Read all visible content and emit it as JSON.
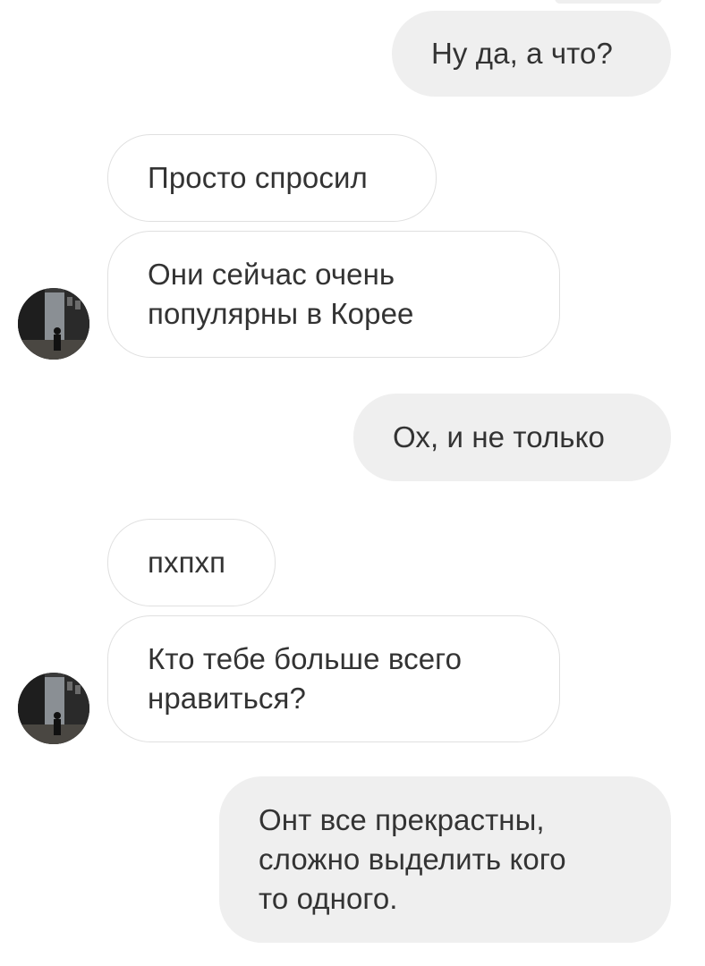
{
  "messages": [
    {
      "id": "m1",
      "side": "outgoing",
      "text": "Ну да, а что?"
    },
    {
      "id": "m2",
      "side": "incoming",
      "text": "Просто спросил"
    },
    {
      "id": "m3",
      "side": "incoming",
      "text": "Они сейчас очень\nпопулярны в Корее"
    },
    {
      "id": "m4",
      "side": "outgoing",
      "text": "Ох, и не только"
    },
    {
      "id": "m5",
      "side": "incoming",
      "text": "пхпхп"
    },
    {
      "id": "m6",
      "side": "incoming",
      "text": "Кто тебе больше всего\nнравиться?"
    },
    {
      "id": "m7",
      "side": "outgoing",
      "text": "Онт все прекрастны,\nсложно выделить кого\nто одного."
    }
  ],
  "colors": {
    "outgoing_bubble": "#efefef",
    "incoming_border": "#e0e0e0",
    "text": "#333333"
  },
  "icons": {
    "avatar": "avatar-photo-street"
  }
}
